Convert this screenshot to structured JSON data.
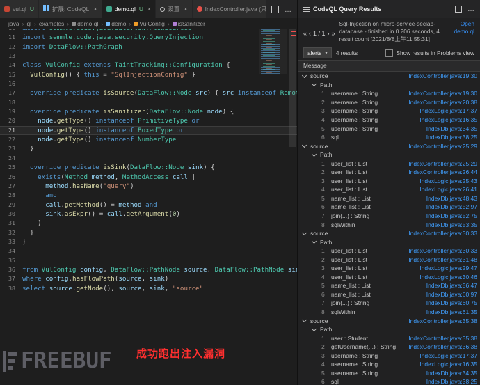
{
  "window": {
    "tabs": [
      {
        "label": "vul.ql",
        "git": "U",
        "icon": "ql-file-icon",
        "active": false,
        "closable": false
      },
      {
        "label": "扩展: CodeQL",
        "icon": "extensions-icon",
        "active": false,
        "closable": true
      },
      {
        "label": "demo.ql",
        "git": "U",
        "icon": "ql-file-icon green",
        "active": true,
        "closable": true
      },
      {
        "label": "设置",
        "icon": "gear-icon",
        "active": false,
        "closable": true
      },
      {
        "label": "IndexController.java (只读)",
        "icon": "java-file-icon",
        "active": false,
        "closable": true
      }
    ]
  },
  "breadcrumb": [
    {
      "label": "java"
    },
    {
      "label": "ql"
    },
    {
      "label": "examples"
    },
    {
      "label": "demo.ql",
      "icon": "file-icon"
    },
    {
      "label": "demo",
      "icon": "namespace-icon"
    },
    {
      "label": "VulConfig",
      "icon": "class-icon"
    },
    {
      "label": "isSanitizer",
      "icon": "method-icon"
    }
  ],
  "editor": {
    "current_line": 21,
    "lines": [
      {
        "num": "10",
        "tokens": [
          [
            "k",
            "import"
          ],
          [
            "t",
            " semmle.code.java.dataflow.FlowSources"
          ]
        ]
      },
      {
        "num": "11",
        "tokens": [
          [
            "k",
            "import"
          ],
          [
            "t",
            " semmle.code.java.security.QueryInjection"
          ]
        ]
      },
      {
        "num": "12",
        "tokens": [
          [
            "k",
            "import"
          ],
          [
            "t",
            " DataFlow::PathGraph"
          ]
        ]
      },
      {
        "num": "13",
        "tokens": []
      },
      {
        "num": "14",
        "tokens": [
          [
            "k",
            "class"
          ],
          [
            "t",
            " VulConfig"
          ],
          [
            "k",
            " extends"
          ],
          [
            "t",
            " TaintTracking::Configuration"
          ],
          [
            "p",
            " {"
          ]
        ]
      },
      {
        "num": "15",
        "tokens": [
          [
            "p",
            "  "
          ],
          [
            "f",
            "VulConfig"
          ],
          [
            "p",
            "() { "
          ],
          [
            "k",
            "this"
          ],
          [
            "p",
            " = "
          ],
          [
            "s",
            "\"SqlInjectionConfig\""
          ],
          [
            "p",
            " }"
          ]
        ]
      },
      {
        "num": "16",
        "tokens": []
      },
      {
        "num": "17",
        "tokens": [
          [
            "p",
            "  "
          ],
          [
            "k",
            "override predicate"
          ],
          [
            "f",
            " isSource"
          ],
          [
            "p",
            "("
          ],
          [
            "t",
            "DataFlow::Node"
          ],
          [
            "v",
            " src"
          ],
          [
            "p",
            ") { "
          ],
          [
            "v",
            "src"
          ],
          [
            "k",
            " instanceof"
          ],
          [
            "t",
            " RemoteFlowSource"
          ],
          [
            "p",
            " }"
          ]
        ]
      },
      {
        "num": "18",
        "tokens": []
      },
      {
        "num": "19",
        "tokens": [
          [
            "p",
            "  "
          ],
          [
            "k",
            "override predicate"
          ],
          [
            "f",
            " isSanitizer"
          ],
          [
            "p",
            "("
          ],
          [
            "t",
            "DataFlow::Node"
          ],
          [
            "v",
            " node"
          ],
          [
            "p",
            ") {"
          ]
        ]
      },
      {
        "num": "20",
        "tokens": [
          [
            "p",
            "    "
          ],
          [
            "v",
            "node"
          ],
          [
            "p",
            "."
          ],
          [
            "f",
            "getType"
          ],
          [
            "p",
            "() "
          ],
          [
            "k",
            "instanceof"
          ],
          [
            "t",
            " PrimitiveType"
          ],
          [
            "k",
            " or"
          ]
        ]
      },
      {
        "num": "21",
        "tokens": [
          [
            "p",
            "    "
          ],
          [
            "v",
            "node"
          ],
          [
            "p",
            "."
          ],
          [
            "f",
            "getType"
          ],
          [
            "p",
            "() "
          ],
          [
            "k",
            "instanceof"
          ],
          [
            "t",
            " BoxedType"
          ],
          [
            "k",
            " or"
          ]
        ]
      },
      {
        "num": "22",
        "tokens": [
          [
            "p",
            "    "
          ],
          [
            "v",
            "node"
          ],
          [
            "p",
            "."
          ],
          [
            "f",
            "getType"
          ],
          [
            "p",
            "() "
          ],
          [
            "k",
            "instanceof"
          ],
          [
            "t",
            " NumberType"
          ]
        ]
      },
      {
        "num": "23",
        "tokens": [
          [
            "p",
            "  }"
          ]
        ]
      },
      {
        "num": "24",
        "tokens": []
      },
      {
        "num": "25",
        "tokens": [
          [
            "p",
            "  "
          ],
          [
            "k",
            "override predicate"
          ],
          [
            "f",
            " isSink"
          ],
          [
            "p",
            "("
          ],
          [
            "t",
            "DataFlow::Node"
          ],
          [
            "v",
            " sink"
          ],
          [
            "p",
            ") {"
          ]
        ]
      },
      {
        "num": "26",
        "tokens": [
          [
            "p",
            "    "
          ],
          [
            "k",
            "exists"
          ],
          [
            "p",
            "("
          ],
          [
            "t",
            "Method"
          ],
          [
            "v",
            " method"
          ],
          [
            "p",
            ", "
          ],
          [
            "t",
            "MethodAccess"
          ],
          [
            "v",
            " call"
          ],
          [
            "p",
            " |"
          ]
        ]
      },
      {
        "num": "27",
        "tokens": [
          [
            "p",
            "      "
          ],
          [
            "v",
            "method"
          ],
          [
            "p",
            "."
          ],
          [
            "f",
            "hasName"
          ],
          [
            "p",
            "("
          ],
          [
            "s",
            "\"query\""
          ],
          [
            "p",
            ")"
          ]
        ]
      },
      {
        "num": "28",
        "tokens": [
          [
            "p",
            "      "
          ],
          [
            "k",
            "and"
          ]
        ]
      },
      {
        "num": "29",
        "tokens": [
          [
            "p",
            "      "
          ],
          [
            "v",
            "call"
          ],
          [
            "p",
            "."
          ],
          [
            "f",
            "getMethod"
          ],
          [
            "p",
            "() = "
          ],
          [
            "v",
            "method"
          ],
          [
            "k",
            " and"
          ]
        ]
      },
      {
        "num": "30",
        "tokens": [
          [
            "p",
            "      "
          ],
          [
            "v",
            "sink"
          ],
          [
            "p",
            "."
          ],
          [
            "f",
            "asExpr"
          ],
          [
            "p",
            "() = "
          ],
          [
            "v",
            "call"
          ],
          [
            "p",
            "."
          ],
          [
            "f",
            "getArgument"
          ],
          [
            "p",
            "("
          ],
          [
            "n",
            "0"
          ],
          [
            "p",
            ")"
          ]
        ]
      },
      {
        "num": "31",
        "tokens": [
          [
            "p",
            "    )"
          ]
        ]
      },
      {
        "num": "32",
        "tokens": [
          [
            "p",
            "  }"
          ]
        ]
      },
      {
        "num": "33",
        "tokens": [
          [
            "p",
            "}"
          ]
        ]
      },
      {
        "num": "34",
        "tokens": []
      },
      {
        "num": "35",
        "tokens": []
      },
      {
        "num": "36",
        "tokens": [
          [
            "k",
            "from"
          ],
          [
            "t",
            " VulConfig"
          ],
          [
            "v",
            " config"
          ],
          [
            "p",
            ", "
          ],
          [
            "t",
            "DataFlow::PathNode"
          ],
          [
            "v",
            " source"
          ],
          [
            "p",
            ", "
          ],
          [
            "t",
            "DataFlow::PathNode"
          ],
          [
            "v",
            " sink"
          ]
        ]
      },
      {
        "num": "37",
        "tokens": [
          [
            "k",
            "where"
          ],
          [
            "v",
            " config"
          ],
          [
            "p",
            "."
          ],
          [
            "f",
            "hasFlowPath"
          ],
          [
            "p",
            "("
          ],
          [
            "v",
            "source"
          ],
          [
            "p",
            ", "
          ],
          [
            "v",
            "sink"
          ],
          [
            "p",
            ")"
          ]
        ]
      },
      {
        "num": "38",
        "tokens": [
          [
            "k",
            "select"
          ],
          [
            "v",
            " source"
          ],
          [
            "p",
            "."
          ],
          [
            "f",
            "getNode"
          ],
          [
            "p",
            "(), "
          ],
          [
            "v",
            "source"
          ],
          [
            "p",
            ", "
          ],
          [
            "v",
            "sink"
          ],
          [
            "p",
            ", "
          ],
          [
            "s",
            "\"source\""
          ]
        ]
      }
    ]
  },
  "annotation": {
    "text": "成功跑出注入漏洞"
  },
  "watermark": {
    "text": "FREEBUF"
  },
  "results": {
    "title": "CodeQL Query Results",
    "pager": {
      "first": "«",
      "prev": "‹",
      "label": "1  /  1",
      "next": "›",
      "last": "»"
    },
    "summary": "Sql-Injection on micro-service-seclab-database - finished in 0.206 seconds, 4 result count [2021/8/8上午11:55:31]",
    "open_link": "Open demo.ql",
    "view_select": "alerts",
    "results_count": "4 results",
    "problems_checkbox_label": "Show results in Problems view",
    "column_header": "Message",
    "groups": [
      {
        "label": "source",
        "location": "IndexController.java:19:30",
        "path_label": "Path",
        "steps": [
          {
            "n": "1",
            "label": "username : String",
            "location": "IndexController.java:19:30"
          },
          {
            "n": "2",
            "label": "username : String",
            "location": "IndexController.java:20:38"
          },
          {
            "n": "3",
            "label": "username : String",
            "location": "IndexLogic.java:17:37"
          },
          {
            "n": "4",
            "label": "username : String",
            "location": "IndexLogic.java:16:35"
          },
          {
            "n": "5",
            "label": "username : String",
            "location": "IndexDb.java:34:35"
          },
          {
            "n": "6",
            "label": "sql",
            "location": "IndexDb.java:38:25"
          }
        ]
      },
      {
        "label": "source",
        "location": "IndexController.java:25:29",
        "path_label": "Path",
        "steps": [
          {
            "n": "1",
            "label": "user_list : List",
            "location": "IndexController.java:25:29"
          },
          {
            "n": "2",
            "label": "user_list : List",
            "location": "IndexController.java:26:44"
          },
          {
            "n": "3",
            "label": "user_list : List",
            "location": "IndexLogic.java:25:43"
          },
          {
            "n": "4",
            "label": "user_list : List",
            "location": "IndexLogic.java:26:41"
          },
          {
            "n": "5",
            "label": "name_list : List",
            "location": "IndexDb.java:48:43"
          },
          {
            "n": "6",
            "label": "name_list : List",
            "location": "IndexDb.java:52:97"
          },
          {
            "n": "7",
            "label": "join(...) : String",
            "location": "IndexDb.java:52:75"
          },
          {
            "n": "8",
            "label": "sqlWithin",
            "location": "IndexDb.java:53:35"
          }
        ]
      },
      {
        "label": "source",
        "location": "IndexController.java:30:33",
        "path_label": "Path",
        "steps": [
          {
            "n": "1",
            "label": "user_list : List",
            "location": "IndexController.java:30:33"
          },
          {
            "n": "2",
            "label": "user_list : List",
            "location": "IndexController.java:31:48"
          },
          {
            "n": "3",
            "label": "user_list : List",
            "location": "IndexLogic.java:29:47"
          },
          {
            "n": "4",
            "label": "user_list : List",
            "location": "IndexLogic.java:30:46"
          },
          {
            "n": "5",
            "label": "name_list : List",
            "location": "IndexDb.java:56:47"
          },
          {
            "n": "6",
            "label": "name_list : List",
            "location": "IndexDb.java:60:97"
          },
          {
            "n": "7",
            "label": "join(...) : String",
            "location": "IndexDb.java:60:75"
          },
          {
            "n": "8",
            "label": "sqlWithin",
            "location": "IndexDb.java:61:35"
          }
        ]
      },
      {
        "label": "source",
        "location": "IndexController.java:35:38",
        "path_label": "Path",
        "steps": [
          {
            "n": "1",
            "label": "user : Student",
            "location": "IndexController.java:35:38"
          },
          {
            "n": "2",
            "label": "getUsername(...) : String",
            "location": "IndexController.java:36:38"
          },
          {
            "n": "3",
            "label": "username : String",
            "location": "IndexLogic.java:17:37"
          },
          {
            "n": "4",
            "label": "username : String",
            "location": "IndexLogic.java:16:35"
          },
          {
            "n": "5",
            "label": "username : String",
            "location": "IndexDb.java:34:35"
          },
          {
            "n": "6",
            "label": "sql",
            "location": "IndexDb.java:38:25"
          }
        ]
      }
    ]
  }
}
